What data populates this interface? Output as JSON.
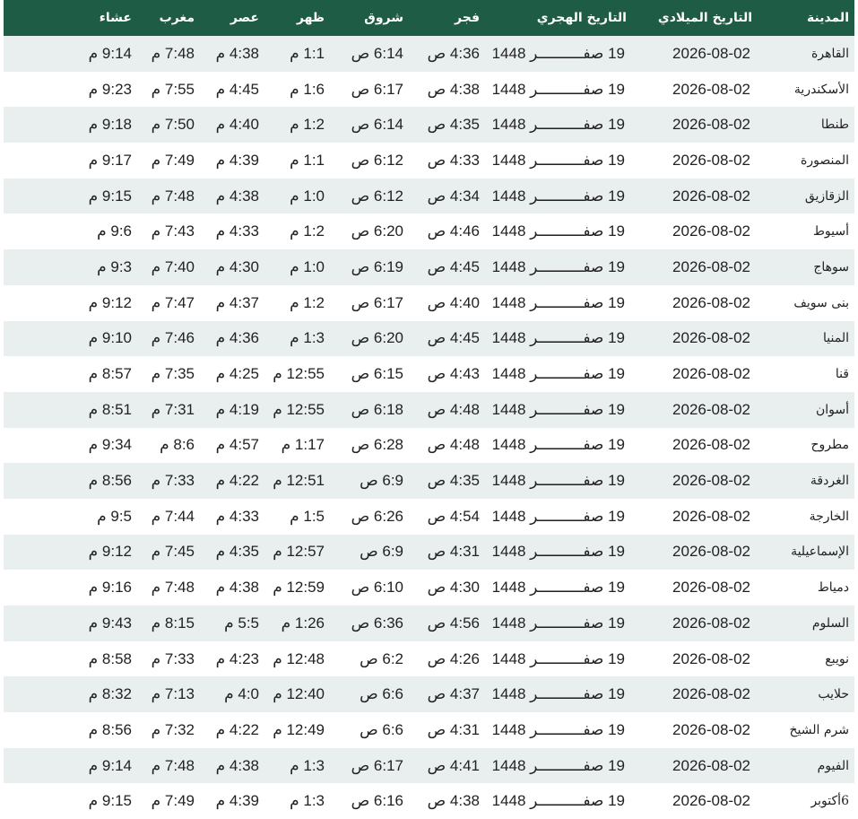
{
  "headers": {
    "city": "المدينة",
    "gregorian": "التاريخ الميلادي",
    "hijri": "التاريخ الهجري",
    "fajr": "فجر",
    "shuruq": "شروق",
    "dhuhr": "ظهر",
    "asr": "عصر",
    "maghrib": "مغرب",
    "isha": "عشاء"
  },
  "rows": [
    {
      "city": "القاهرة",
      "gregorian": "2026-08-02",
      "hijri": "19 صفــــــــــر 1448",
      "fajr": "4:36 ص",
      "shuruq": "6:14 ص",
      "dhuhr": "1:1 م",
      "asr": "4:38 م",
      "maghrib": "7:48 م",
      "isha": "9:14 م"
    },
    {
      "city": "الأسكندرية",
      "gregorian": "2026-08-02",
      "hijri": "19 صفــــــــــر 1448",
      "fajr": "4:38 ص",
      "shuruq": "6:17 ص",
      "dhuhr": "1:6 م",
      "asr": "4:45 م",
      "maghrib": "7:55 م",
      "isha": "9:23 م"
    },
    {
      "city": "طنطا",
      "gregorian": "2026-08-02",
      "hijri": "19 صفــــــــــر 1448",
      "fajr": "4:35 ص",
      "shuruq": "6:14 ص",
      "dhuhr": "1:2 م",
      "asr": "4:40 م",
      "maghrib": "7:50 م",
      "isha": "9:18 م"
    },
    {
      "city": "المنصورة",
      "gregorian": "2026-08-02",
      "hijri": "19 صفــــــــــر 1448",
      "fajr": "4:33 ص",
      "shuruq": "6:12 ص",
      "dhuhr": "1:1 م",
      "asr": "4:39 م",
      "maghrib": "7:49 م",
      "isha": "9:17 م"
    },
    {
      "city": "الزقازيق",
      "gregorian": "2026-08-02",
      "hijri": "19 صفــــــــــر 1448",
      "fajr": "4:34 ص",
      "shuruq": "6:12 ص",
      "dhuhr": "1:0 م",
      "asr": "4:38 م",
      "maghrib": "7:48 م",
      "isha": "9:15 م"
    },
    {
      "city": "أسيوط",
      "gregorian": "2026-08-02",
      "hijri": "19 صفــــــــــر 1448",
      "fajr": "4:46 ص",
      "shuruq": "6:20 ص",
      "dhuhr": "1:2 م",
      "asr": "4:33 م",
      "maghrib": "7:43 م",
      "isha": "9:6 م"
    },
    {
      "city": "سوهاج",
      "gregorian": "2026-08-02",
      "hijri": "19 صفــــــــــر 1448",
      "fajr": "4:45 ص",
      "shuruq": "6:19 ص",
      "dhuhr": "1:0 م",
      "asr": "4:30 م",
      "maghrib": "7:40 م",
      "isha": "9:3 م"
    },
    {
      "city": "بنى سويف",
      "gregorian": "2026-08-02",
      "hijri": "19 صفــــــــــر 1448",
      "fajr": "4:40 ص",
      "shuruq": "6:17 ص",
      "dhuhr": "1:2 م",
      "asr": "4:37 م",
      "maghrib": "7:47 م",
      "isha": "9:12 م"
    },
    {
      "city": "المنيا",
      "gregorian": "2026-08-02",
      "hijri": "19 صفــــــــــر 1448",
      "fajr": "4:45 ص",
      "shuruq": "6:20 ص",
      "dhuhr": "1:3 م",
      "asr": "4:36 م",
      "maghrib": "7:46 م",
      "isha": "9:10 م"
    },
    {
      "city": "قنا",
      "gregorian": "2026-08-02",
      "hijri": "19 صفــــــــــر 1448",
      "fajr": "4:43 ص",
      "shuruq": "6:15 ص",
      "dhuhr": "12:55 م",
      "asr": "4:25 م",
      "maghrib": "7:35 م",
      "isha": "8:57 م"
    },
    {
      "city": "أسوان",
      "gregorian": "2026-08-02",
      "hijri": "19 صفــــــــــر 1448",
      "fajr": "4:48 ص",
      "shuruq": "6:18 ص",
      "dhuhr": "12:55 م",
      "asr": "4:19 م",
      "maghrib": "7:31 م",
      "isha": "8:51 م"
    },
    {
      "city": "مطروح",
      "gregorian": "2026-08-02",
      "hijri": "19 صفــــــــــر 1448",
      "fajr": "4:48 ص",
      "shuruq": "6:28 ص",
      "dhuhr": "1:17 م",
      "asr": "4:57 م",
      "maghrib": "8:6 م",
      "isha": "9:34 م"
    },
    {
      "city": "الغردقة",
      "gregorian": "2026-08-02",
      "hijri": "19 صفــــــــــر 1448",
      "fajr": "4:35 ص",
      "shuruq": "6:9 ص",
      "dhuhr": "12:51 م",
      "asr": "4:22 م",
      "maghrib": "7:33 م",
      "isha": "8:56 م"
    },
    {
      "city": "الخارجة",
      "gregorian": "2026-08-02",
      "hijri": "19 صفــــــــــر 1448",
      "fajr": "4:54 ص",
      "shuruq": "6:26 ص",
      "dhuhr": "1:5 م",
      "asr": "4:33 م",
      "maghrib": "7:44 م",
      "isha": "9:5 م"
    },
    {
      "city": "الإسماعيلية",
      "gregorian": "2026-08-02",
      "hijri": "19 صفــــــــــر 1448",
      "fajr": "4:31 ص",
      "shuruq": "6:9 ص",
      "dhuhr": "12:57 م",
      "asr": "4:35 م",
      "maghrib": "7:45 م",
      "isha": "9:12 م"
    },
    {
      "city": "دمياط",
      "gregorian": "2026-08-02",
      "hijri": "19 صفــــــــــر 1448",
      "fajr": "4:30 ص",
      "shuruq": "6:10 ص",
      "dhuhr": "12:59 م",
      "asr": "4:38 م",
      "maghrib": "7:48 م",
      "isha": "9:16 م"
    },
    {
      "city": "السلوم",
      "gregorian": "2026-08-02",
      "hijri": "19 صفــــــــــر 1448",
      "fajr": "4:56 ص",
      "shuruq": "6:36 ص",
      "dhuhr": "1:26 م",
      "asr": "5:5 م",
      "maghrib": "8:15 م",
      "isha": "9:43 م"
    },
    {
      "city": "نويبع",
      "gregorian": "2026-08-02",
      "hijri": "19 صفــــــــــر 1448",
      "fajr": "4:26 ص",
      "shuruq": "6:2 ص",
      "dhuhr": "12:48 م",
      "asr": "4:23 م",
      "maghrib": "7:33 م",
      "isha": "8:58 م"
    },
    {
      "city": "حلايب",
      "gregorian": "2026-08-02",
      "hijri": "19 صفــــــــــر 1448",
      "fajr": "4:37 ص",
      "shuruq": "6:6 ص",
      "dhuhr": "12:40 م",
      "asr": "4:0 م",
      "maghrib": "7:13 م",
      "isha": "8:32 م"
    },
    {
      "city": "شرم الشيخ",
      "gregorian": "2026-08-02",
      "hijri": "19 صفــــــــــر 1448",
      "fajr": "4:31 ص",
      "shuruq": "6:6 ص",
      "dhuhr": "12:49 م",
      "asr": "4:22 م",
      "maghrib": "7:32 م",
      "isha": "8:56 م"
    },
    {
      "city": "الفيوم",
      "gregorian": "2026-08-02",
      "hijri": "19 صفــــــــــر 1448",
      "fajr": "4:41 ص",
      "shuruq": "6:17 ص",
      "dhuhr": "1:3 م",
      "asr": "4:38 م",
      "maghrib": "7:48 م",
      "isha": "9:14 م"
    },
    {
      "city": "6أكتوبر",
      "gregorian": "2026-08-02",
      "hijri": "19 صفــــــــــر 1448",
      "fajr": "4:38 ص",
      "shuruq": "6:16 ص",
      "dhuhr": "1:3 م",
      "asr": "4:39 م",
      "maghrib": "7:49 م",
      "isha": "9:15 م"
    }
  ],
  "colors": {
    "header_bg": "#1f5c45",
    "header_text": "#ffffff",
    "row_alt_bg": "#e9eeee",
    "row_bg": "#ffffff",
    "text": "#222222"
  }
}
